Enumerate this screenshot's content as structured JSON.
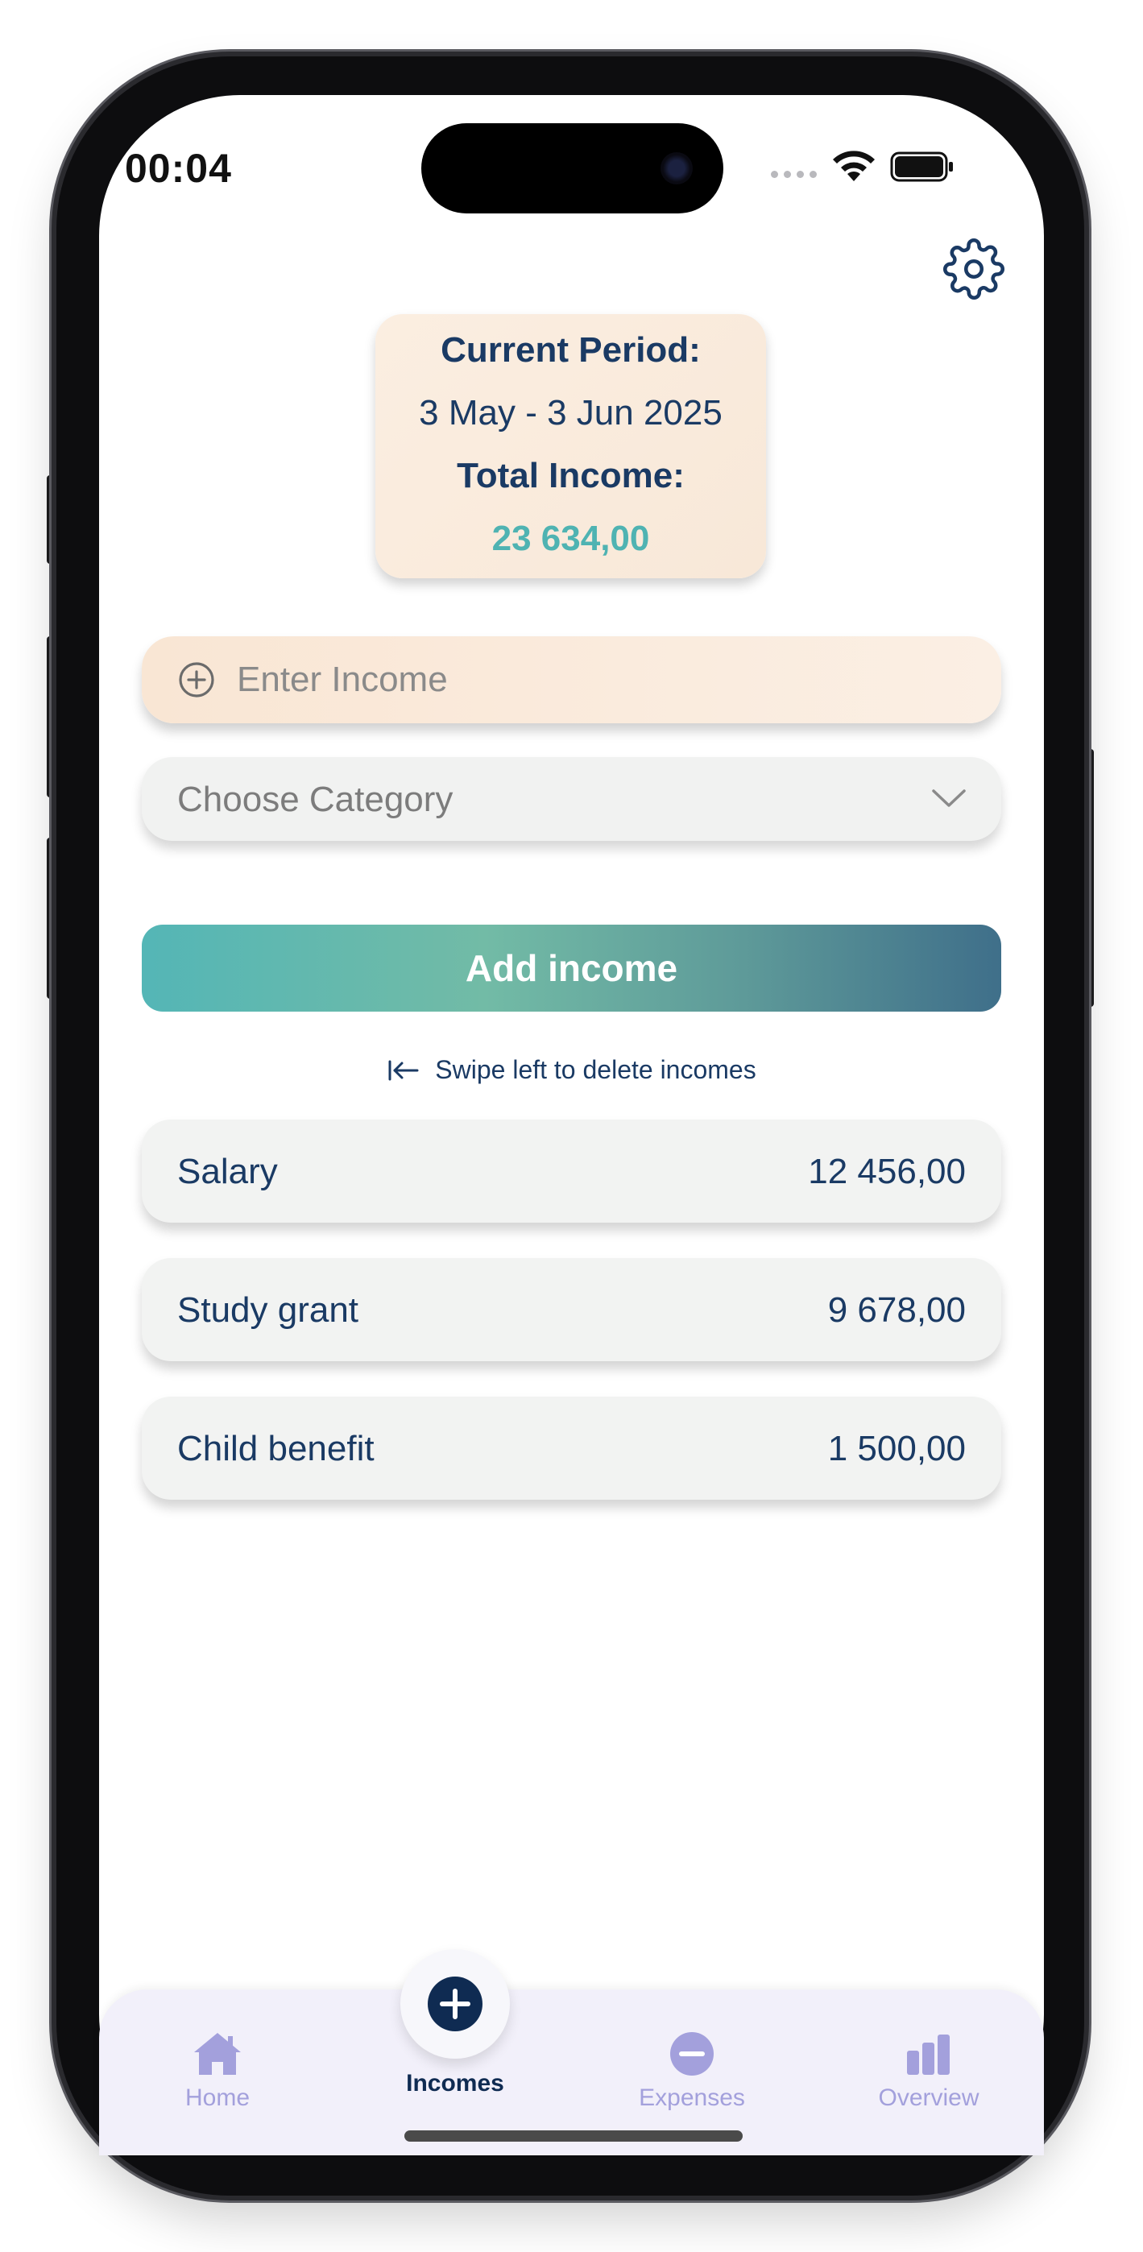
{
  "status_bar": {
    "time": "00:04",
    "signal_icon": "cellular-dots-icon",
    "wifi_icon": "wifi-icon",
    "battery_icon": "battery-full-icon"
  },
  "header": {
    "settings_icon": "gear-icon"
  },
  "period_card": {
    "period_label": "Current Period:",
    "period_value": "3 May - 3 Jun 2025",
    "total_label": "Total Income:",
    "total_value": "23 634,00",
    "total_color": "#4fb3b2"
  },
  "form": {
    "income_placeholder": "Enter Income",
    "income_value": "",
    "category_placeholder": "Choose Category",
    "add_button_label": "Add income"
  },
  "hint": {
    "swipe_text": "Swipe left to delete incomes"
  },
  "incomes": [
    {
      "name": "Salary",
      "amount": "12 456,00"
    },
    {
      "name": "Study grant",
      "amount": "9 678,00"
    },
    {
      "name": "Child benefit",
      "amount": "1 500,00"
    }
  ],
  "tabs": [
    {
      "label": "Home",
      "icon": "home-icon",
      "active": false
    },
    {
      "label": "Incomes",
      "icon": "plus-circle-icon",
      "active": true
    },
    {
      "label": "Expenses",
      "icon": "minus-circle-icon",
      "active": false
    },
    {
      "label": "Overview",
      "icon": "bar-chart-icon",
      "active": false
    }
  ],
  "colors": {
    "primary_text": "#1a3a64",
    "accent_teal": "#4fb3b2",
    "tab_inactive": "#a3a0dc",
    "tab_active": "#0f2b52"
  }
}
